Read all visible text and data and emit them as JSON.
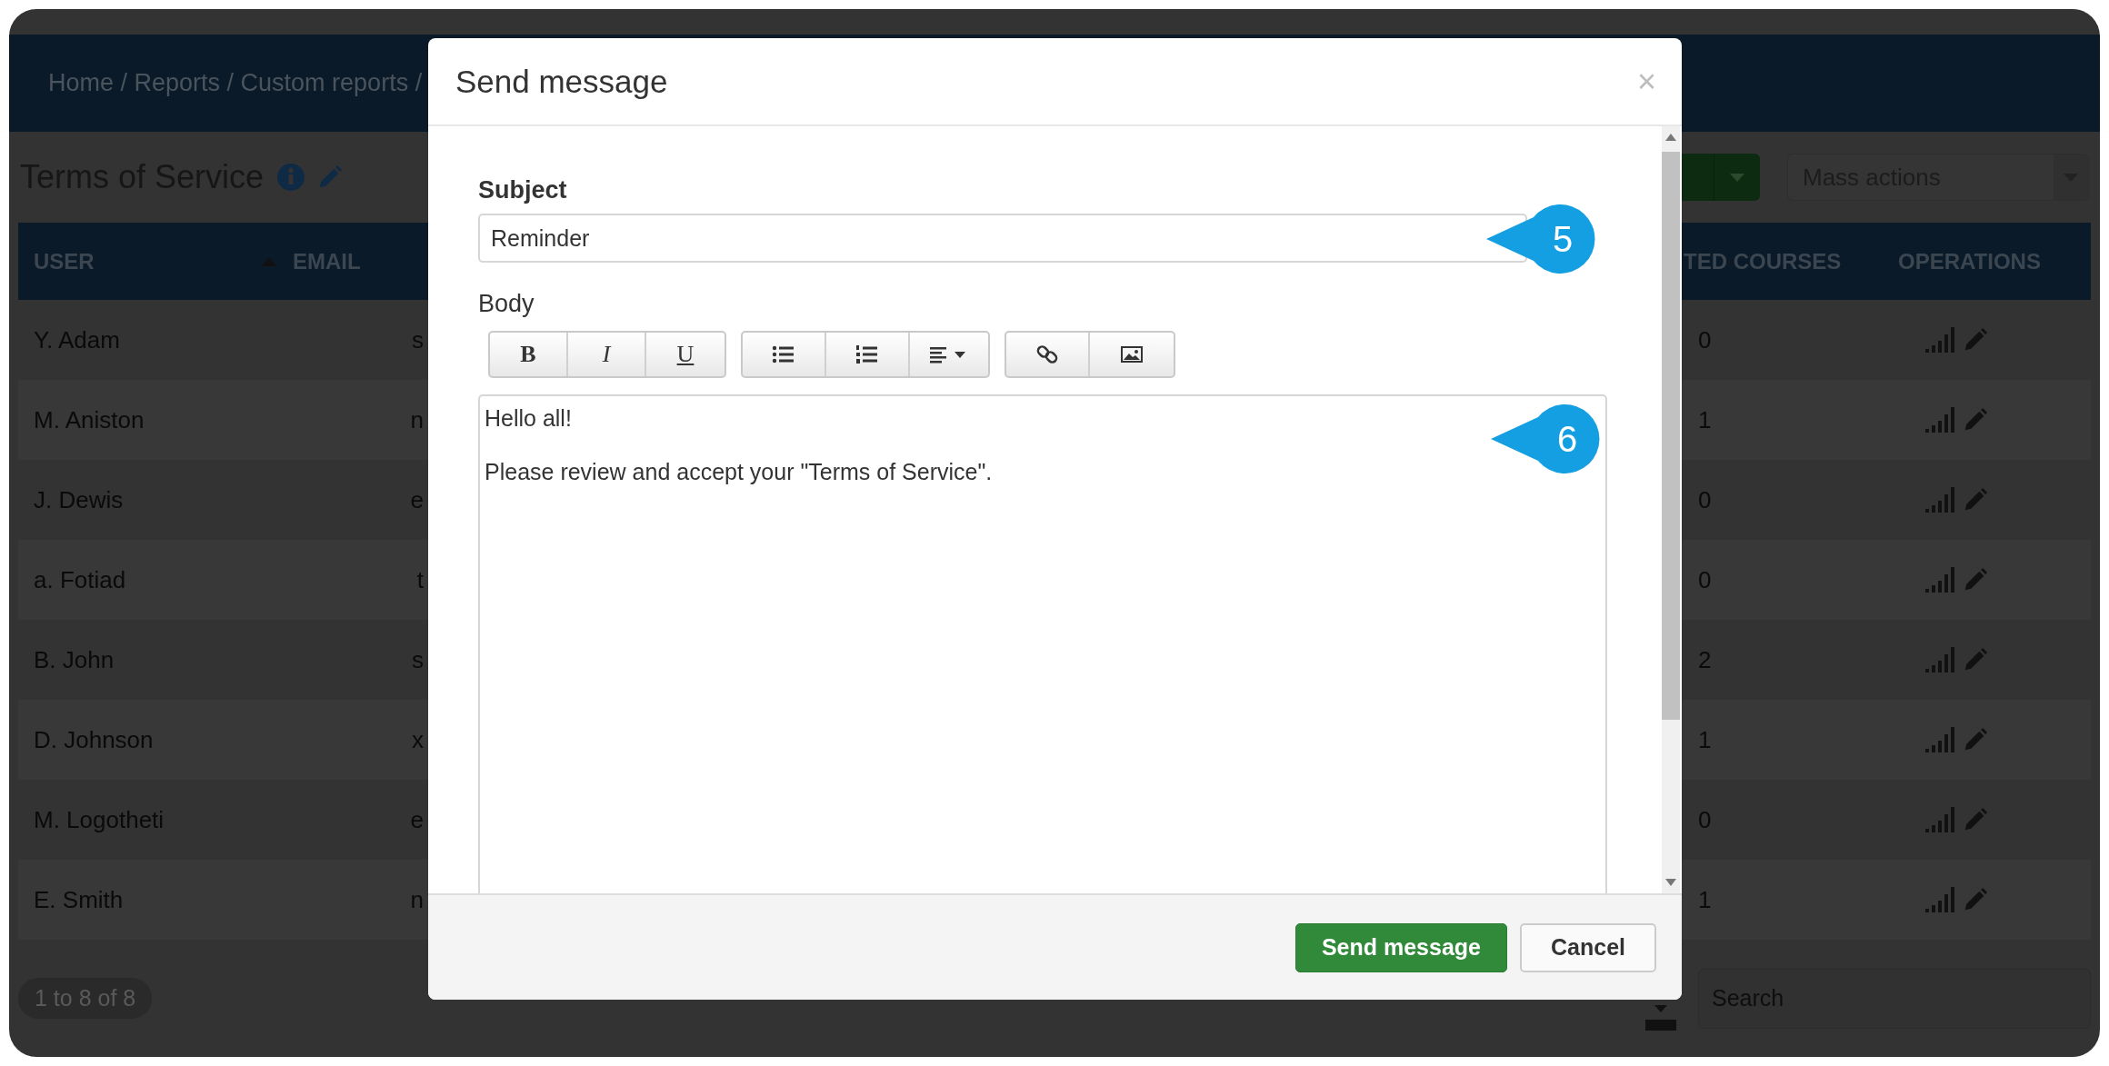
{
  "breadcrumb": "Home / Reports / Custom reports /",
  "page_title": "Terms of Service",
  "mass_actions_select": {
    "value": "Mass actions"
  },
  "table": {
    "columns": [
      {
        "label": "USER",
        "sorted": true
      },
      {
        "label": "EMAIL",
        "sorted": false
      },
      {
        "label": "TED COURSES",
        "sorted": false
      },
      {
        "label": "OPERATIONS",
        "sorted": false
      }
    ],
    "rows": [
      {
        "user": "Y. Adam",
        "email": "s",
        "courses": "0"
      },
      {
        "user": "M. Aniston",
        "email": "n",
        "courses": "1"
      },
      {
        "user": "J. Dewis",
        "email": "e",
        "courses": "0"
      },
      {
        "user": "a. Fotiad",
        "email": "t",
        "courses": "0"
      },
      {
        "user": "B. John",
        "email": "s",
        "courses": "2"
      },
      {
        "user": "D. Johnson",
        "email": "x",
        "courses": "1"
      },
      {
        "user": "M. Logotheti",
        "email": "e",
        "courses": "0"
      },
      {
        "user": "E. Smith",
        "email": "n",
        "courses": "1"
      }
    ]
  },
  "pagination": "1 to 8 of 8",
  "search": {
    "placeholder": "Search"
  },
  "modal": {
    "title": "Send message",
    "close": "×",
    "subject": {
      "label": "Subject",
      "value": "Reminder"
    },
    "body": {
      "label": "Body",
      "toolbar": [
        [
          {
            "kind": "bold",
            "label": "B"
          },
          {
            "kind": "italic",
            "label": "I"
          },
          {
            "kind": "underline",
            "label": "U"
          }
        ],
        [
          {
            "kind": "bullet_list"
          },
          {
            "kind": "numbered_list"
          },
          {
            "kind": "align"
          }
        ],
        [
          {
            "kind": "link"
          },
          {
            "kind": "image"
          }
        ]
      ],
      "paragraphs": [
        "Hello all!",
        "Please review and accept your \"Terms of Service\"."
      ]
    },
    "buttons": [
      {
        "label": "Send message",
        "kind": "primary"
      },
      {
        "label": "Cancel",
        "kind": "default"
      }
    ]
  },
  "callouts": [
    {
      "label": "5"
    },
    {
      "label": "6"
    }
  ]
}
